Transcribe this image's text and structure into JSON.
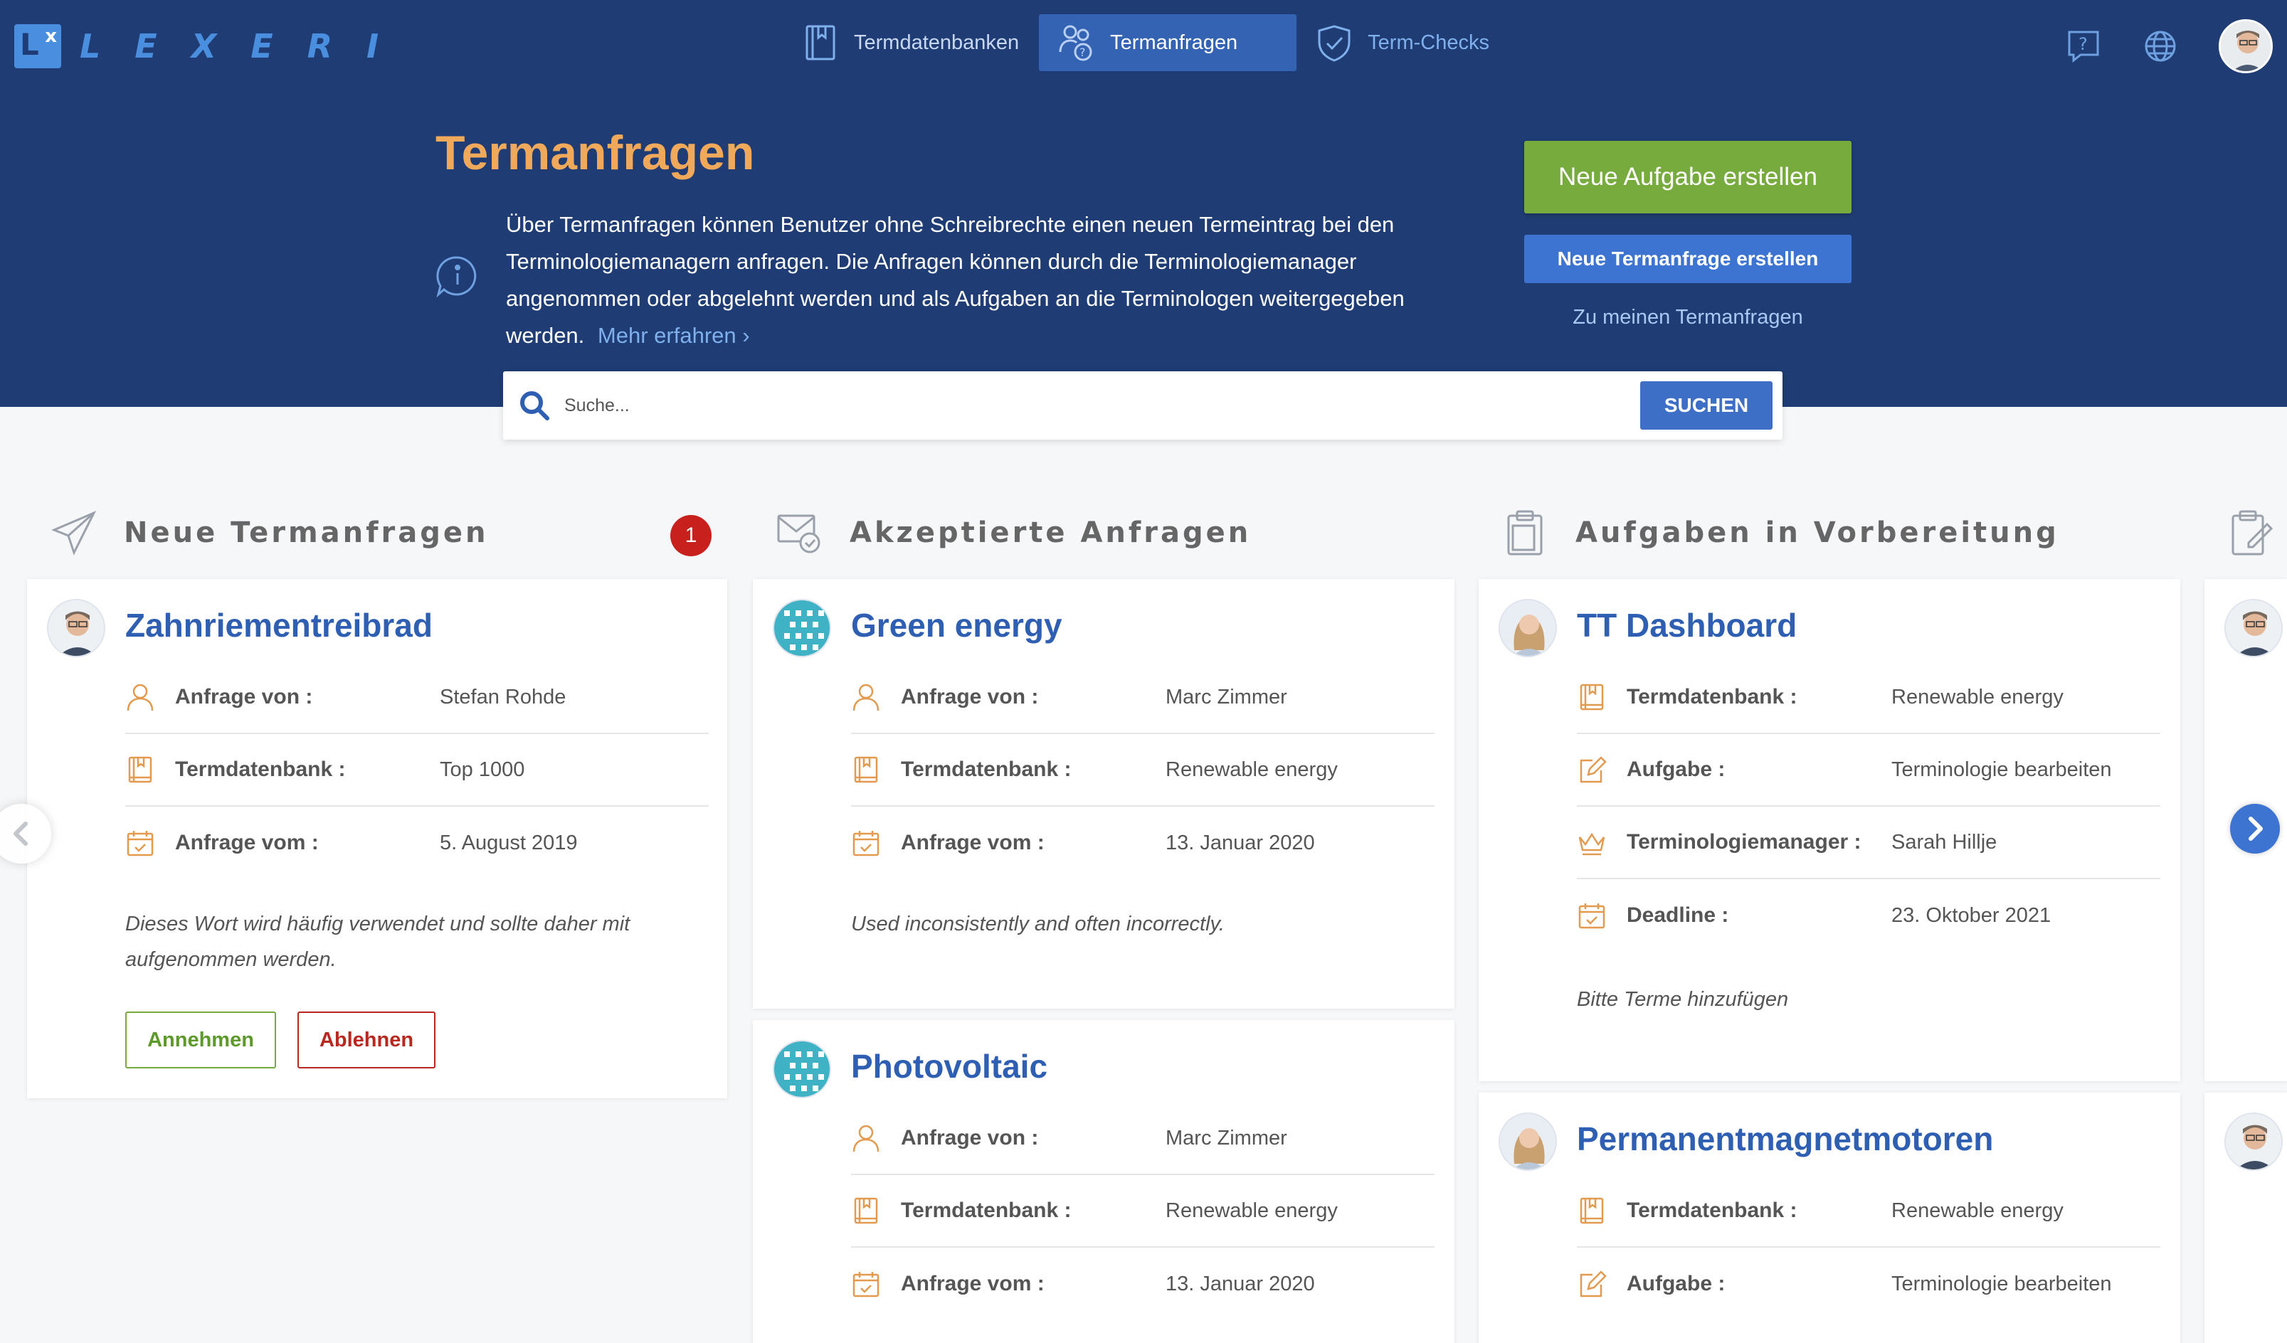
{
  "app": {
    "logo_mark": "L",
    "logo_mark_sup": "x",
    "logo_text": "LEXERI"
  },
  "nav": {
    "items": [
      {
        "label": "Termdatenbanken",
        "icon": "book-icon"
      },
      {
        "label": "Termanfragen",
        "icon": "users-question-icon"
      },
      {
        "label": "Term-Checks",
        "icon": "shield-check-icon"
      }
    ],
    "active_index": 1,
    "right_icons": [
      "help-icon",
      "globe-icon",
      "user-avatar"
    ]
  },
  "header": {
    "title": "Termanfragen",
    "intro": "Über Termanfragen können Benutzer ohne Schreibrechte einen neuen Termeintrag bei den Terminologiemanagern anfragen. Die Anfragen können durch die Terminologiemanager angenommen oder abgelehnt werden und als Aufgaben an die Terminologen weitergegeben werden.",
    "more_link": "Mehr erfahren",
    "btn_new_task": "Neue Aufgabe erstellen",
    "btn_new_request": "Neue Termanfrage erstellen",
    "link_my_requests": "Zu meinen Termanfragen"
  },
  "search": {
    "placeholder": "Suche...",
    "button": "SUCHEN"
  },
  "columns": [
    {
      "title": "Neue Termanfragen",
      "icon": "paper-plane-icon",
      "badge": "1",
      "cards": [
        {
          "title": "Zahnriementreibrad",
          "avatar": "man-avatar",
          "rows": [
            {
              "icon": "user-icon",
              "label": "Anfrage von :",
              "value": "Stefan Rohde"
            },
            {
              "icon": "book-icon",
              "label": "Termdatenbank :",
              "value": "Top 1000"
            },
            {
              "icon": "calendar-icon",
              "label": "Anfrage vom :",
              "value": "5. August 2019"
            }
          ],
          "note": "Dieses Wort wird häufig verwendet und sollte daher mit aufgenommen werden.",
          "btn_accept": "Annehmen",
          "btn_reject": "Ablehnen"
        }
      ]
    },
    {
      "title": "Akzeptierte Anfragen",
      "icon": "mail-check-icon",
      "cards": [
        {
          "title": "Green energy",
          "avatar": "pattern-avatar",
          "rows": [
            {
              "icon": "user-icon",
              "label": "Anfrage von :",
              "value": "Marc Zimmer"
            },
            {
              "icon": "book-icon",
              "label": "Termdatenbank :",
              "value": "Renewable energy"
            },
            {
              "icon": "calendar-icon",
              "label": "Anfrage vom :",
              "value": "13. Januar 2020"
            }
          ],
          "note": "Used inconsistently and often incorrectly."
        },
        {
          "title": "Photovoltaic",
          "avatar": "pattern-avatar",
          "rows": [
            {
              "icon": "user-icon",
              "label": "Anfrage von :",
              "value": "Marc Zimmer"
            },
            {
              "icon": "book-icon",
              "label": "Termdatenbank :",
              "value": "Renewable energy"
            },
            {
              "icon": "calendar-icon",
              "label": "Anfrage vom :",
              "value": "13. Januar 2020"
            }
          ]
        }
      ]
    },
    {
      "title": "Aufgaben in Vorbereitung",
      "icon": "clipboard-icon",
      "cards": [
        {
          "title": "TT Dashboard",
          "avatar": "woman-avatar",
          "rows": [
            {
              "icon": "book-icon",
              "label": "Termdatenbank :",
              "value": "Renewable energy"
            },
            {
              "icon": "edit-icon",
              "label": "Aufgabe :",
              "value": "Terminologie bearbeiten"
            },
            {
              "icon": "crown-icon",
              "label": "Terminologiemanager :",
              "value": "Sarah Hillje"
            },
            {
              "icon": "calendar-icon",
              "label": "Deadline :",
              "value": "23. Oktober 2021"
            }
          ],
          "note": "Bitte Terme hinzufügen"
        },
        {
          "title": "Permanentmagnetmotoren",
          "avatar": "woman-avatar",
          "rows": [
            {
              "icon": "book-icon",
              "label": "Termdatenbank :",
              "value": "Renewable energy"
            },
            {
              "icon": "edit-icon",
              "label": "Aufgabe :",
              "value": "Terminologie bearbeiten"
            }
          ]
        }
      ]
    },
    {
      "icon": "clipboard-edit-icon"
    }
  ],
  "carousel": {
    "prev_icon": "chevron-left-icon",
    "next_icon": "chevron-right-icon"
  },
  "colors": {
    "navy": "#1f3d74",
    "accent_orange": "#f0a85a",
    "accent_blue": "#3d74d1",
    "green": "#77ab3e",
    "red": "#c8211d",
    "icon_orange": "#e39a4e"
  }
}
